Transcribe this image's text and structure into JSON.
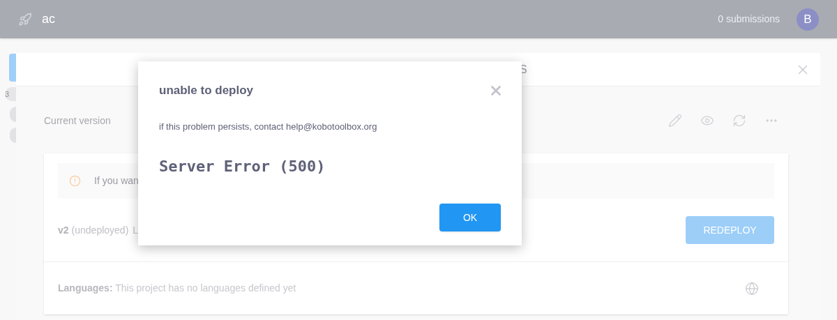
{
  "header": {
    "title": "ac",
    "submissions": "0 submissions",
    "avatar": "B"
  },
  "sidebar": {
    "badges": [
      "3"
    ]
  },
  "panel": {
    "tab_fragment": "S",
    "current_version_label": "Current version",
    "alert": {
      "text": "If you wan"
    },
    "version": {
      "name": "v2",
      "status": "(undeployed)",
      "fragment": "L",
      "button": "REDEPLOY"
    },
    "languages": {
      "label": "Languages:",
      "text": "This project has no languages defined yet"
    }
  },
  "modal": {
    "title": "unable to deploy",
    "message": "if this problem persists, contact help@kobotoolbox.org",
    "error": "Server Error (500)",
    "button": "OK"
  }
}
